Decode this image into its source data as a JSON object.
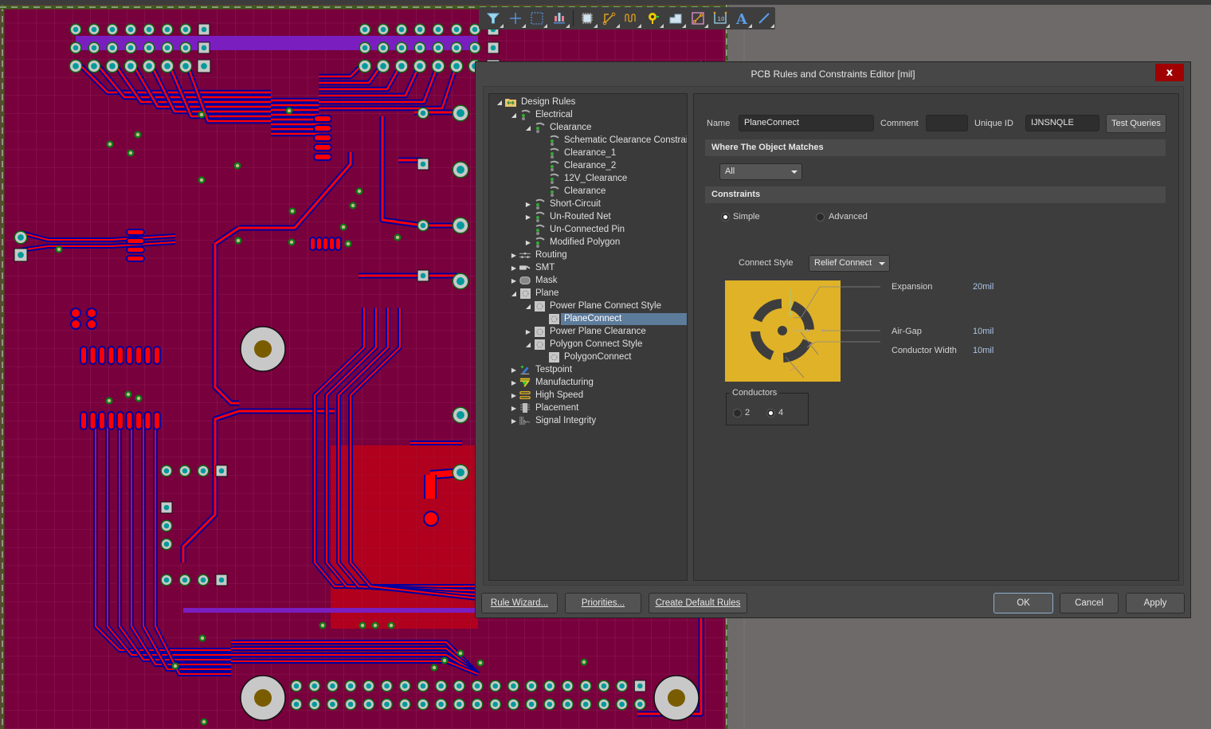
{
  "dialog": {
    "title": "PCB Rules and Constraints Editor [mil]",
    "close_label": "x"
  },
  "tree": {
    "items": [
      {
        "label": "Design Rules",
        "level": 0,
        "toggle": "expanded",
        "icon": "rules-folder-icon"
      },
      {
        "label": "Electrical",
        "level": 1,
        "toggle": "expanded",
        "icon": "electrical-rule-icon"
      },
      {
        "label": "Clearance",
        "level": 2,
        "toggle": "expanded",
        "icon": "electrical-rule-icon"
      },
      {
        "label": "Schematic Clearance Constrain",
        "level": 3,
        "toggle": "none",
        "icon": "electrical-rule-icon"
      },
      {
        "label": "Clearance_1",
        "level": 3,
        "toggle": "none",
        "icon": "electrical-rule-icon"
      },
      {
        "label": "Clearance_2",
        "level": 3,
        "toggle": "none",
        "icon": "electrical-rule-icon"
      },
      {
        "label": "12V_Clearance",
        "level": 3,
        "toggle": "none",
        "icon": "electrical-rule-icon"
      },
      {
        "label": "Clearance",
        "level": 3,
        "toggle": "none",
        "icon": "electrical-rule-icon"
      },
      {
        "label": "Short-Circuit",
        "level": 2,
        "toggle": "collapsed",
        "icon": "electrical-rule-icon"
      },
      {
        "label": "Un-Routed Net",
        "level": 2,
        "toggle": "collapsed",
        "icon": "electrical-rule-icon"
      },
      {
        "label": "Un-Connected Pin",
        "level": 2,
        "toggle": "none",
        "icon": "electrical-rule-icon"
      },
      {
        "label": "Modified Polygon",
        "level": 2,
        "toggle": "collapsed",
        "icon": "electrical-rule-icon"
      },
      {
        "label": "Routing",
        "level": 1,
        "toggle": "collapsed",
        "icon": "routing-icon"
      },
      {
        "label": "SMT",
        "level": 1,
        "toggle": "collapsed",
        "icon": "smt-icon"
      },
      {
        "label": "Mask",
        "level": 1,
        "toggle": "collapsed",
        "icon": "mask-icon"
      },
      {
        "label": "Plane",
        "level": 1,
        "toggle": "expanded",
        "icon": "plane-icon"
      },
      {
        "label": "Power Plane Connect Style",
        "level": 2,
        "toggle": "expanded",
        "icon": "plane-icon"
      },
      {
        "label": "PlaneConnect",
        "level": 3,
        "toggle": "none",
        "icon": "plane-icon",
        "selected": true
      },
      {
        "label": "Power Plane Clearance",
        "level": 2,
        "toggle": "collapsed",
        "icon": "plane-icon"
      },
      {
        "label": "Polygon Connect Style",
        "level": 2,
        "toggle": "expanded",
        "icon": "plane-icon"
      },
      {
        "label": "PolygonConnect",
        "level": 3,
        "toggle": "none",
        "icon": "plane-icon"
      },
      {
        "label": "Testpoint",
        "level": 1,
        "toggle": "collapsed",
        "icon": "testpoint-icon"
      },
      {
        "label": "Manufacturing",
        "level": 1,
        "toggle": "collapsed",
        "icon": "manufacturing-icon"
      },
      {
        "label": "High Speed",
        "level": 1,
        "toggle": "collapsed",
        "icon": "high-speed-icon"
      },
      {
        "label": "Placement",
        "level": 1,
        "toggle": "collapsed",
        "icon": "placement-icon"
      },
      {
        "label": "Signal Integrity",
        "level": 1,
        "toggle": "collapsed",
        "icon": "signal-integrity-icon"
      }
    ]
  },
  "rule": {
    "name_label": "Name",
    "name_value": "PlaneConnect",
    "comment_label": "Comment",
    "comment_value": "",
    "unique_id_label": "Unique ID",
    "unique_id_value": "IJNSNQLE",
    "test_queries_label": "Test Queries",
    "where_matches_header": "Where The Object Matches",
    "where_matches_value": "All",
    "constraints_header": "Constraints",
    "mode_simple": "Simple",
    "mode_advanced": "Advanced",
    "mode_selected": "Simple",
    "connect_style_label": "Connect Style",
    "connect_style_value": "Relief Connect",
    "expansion_label": "Expansion",
    "expansion_value": "20mil",
    "air_gap_label": "Air-Gap",
    "air_gap_value": "10mil",
    "conductor_width_label": "Conductor Width",
    "conductor_width_value": "10mil",
    "conductors_label": "Conductors",
    "conductors_option_2": "2",
    "conductors_option_4": "4",
    "conductors_selected": "4"
  },
  "footer": {
    "rule_wizard": "Rule Wizard...",
    "priorities": "Priorities...",
    "create_default_rules": "Create Default Rules",
    "ok": "OK",
    "cancel": "Cancel",
    "apply": "Apply"
  },
  "toolbar": {
    "tools": [
      "filter-icon",
      "crosshair-icon",
      "select-rect-icon",
      "align-icon",
      "component-icon",
      "route-icon",
      "diff-pair-icon",
      "via-icon",
      "polygon-icon",
      "interactive-route-icon",
      "dimension-icon",
      "text-icon",
      "line-icon"
    ]
  },
  "colors": {
    "pcb_background": "#78003c",
    "top_layer": "#ff0000",
    "bottom_layer": "#0000a0",
    "pad_ring": "#c8c8c8",
    "pad_hole": "#009a9a",
    "relief_plane": "#e0b228",
    "selection": "#5d7b9b",
    "close_button": "#a00000"
  }
}
